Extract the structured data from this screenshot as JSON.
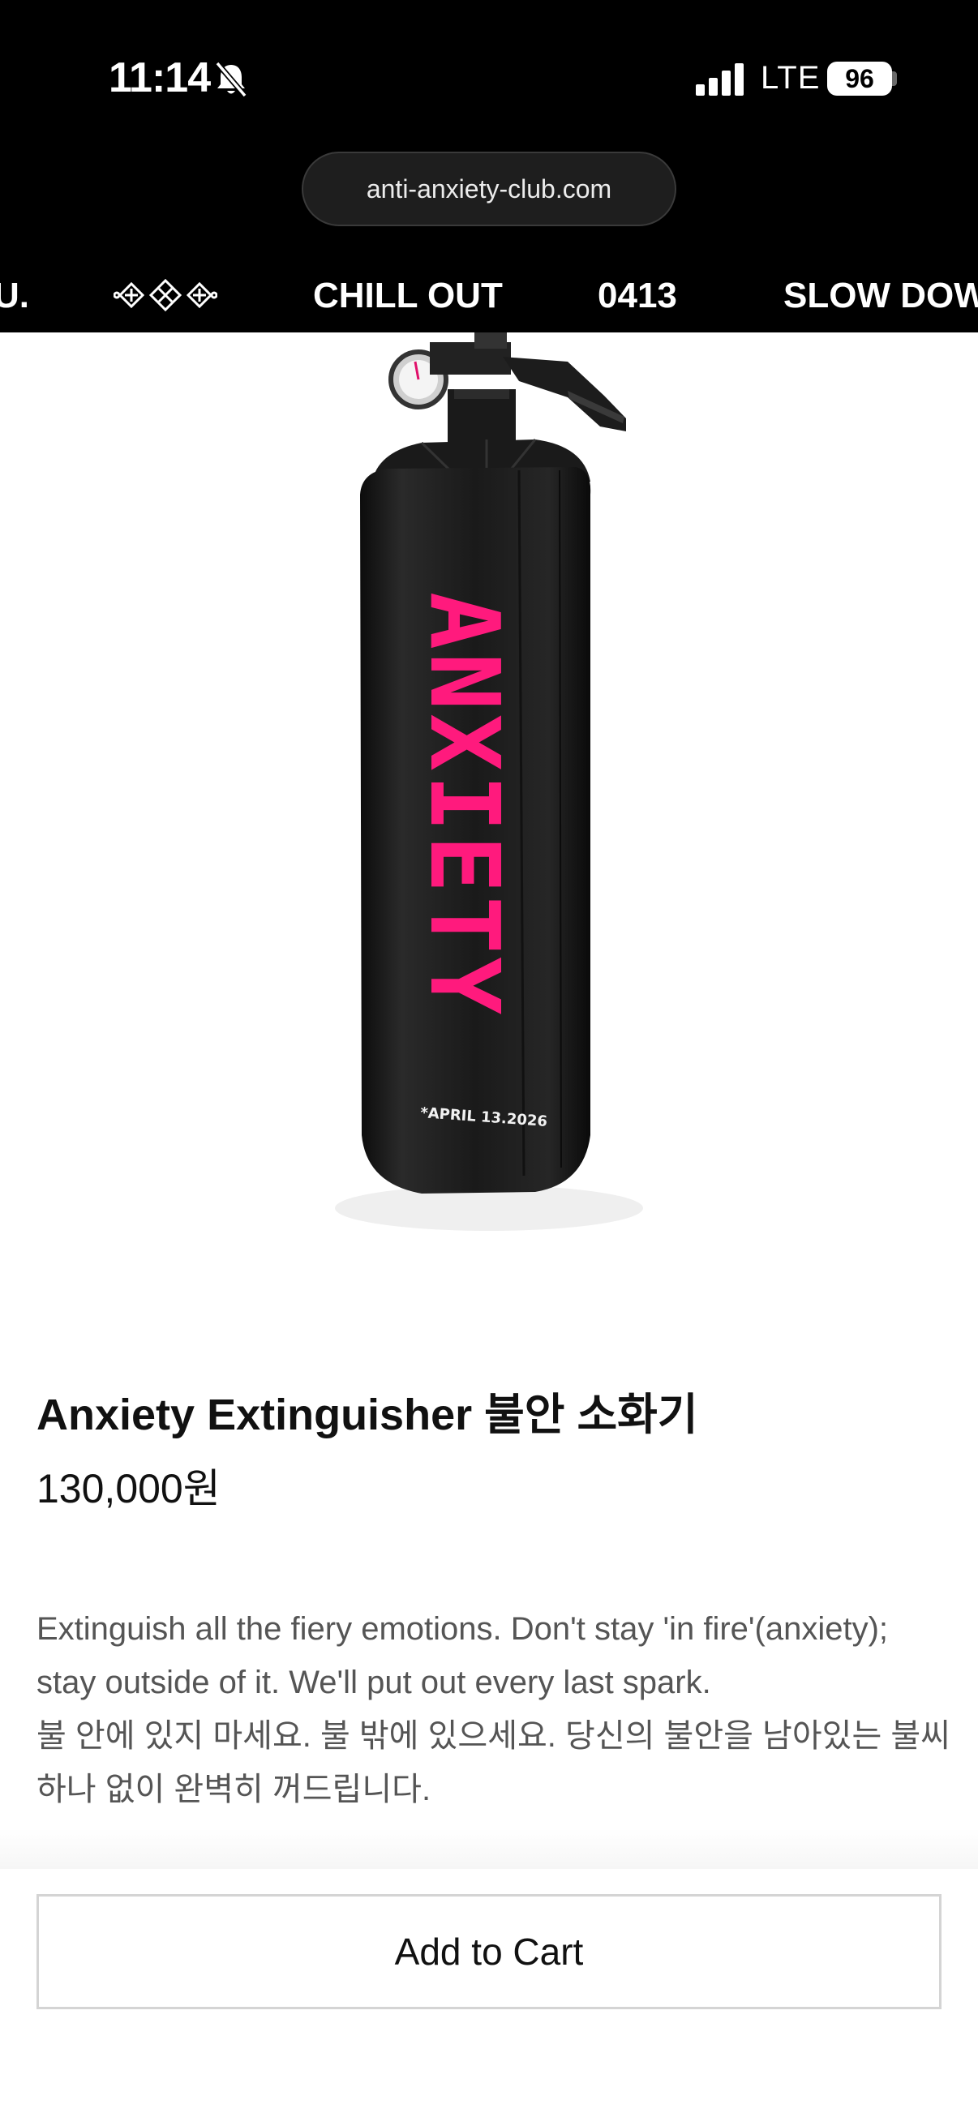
{
  "status_bar": {
    "time": "11:14",
    "network": "LTE",
    "battery": "96"
  },
  "browser": {
    "url": "anti-anxiety-club.com"
  },
  "nav": {
    "items": [
      "U.",
      "CHILL OUT",
      "0413",
      "SLOW DOW"
    ]
  },
  "product": {
    "image_print_text": "ANXIETY",
    "image_date_text": "*APRIL 13.2026",
    "title": "Anxiety Extinguisher 불안 소화기",
    "price": "130,000원",
    "description": [
      "Extinguish all the fiery emotions. Don't stay 'in fire'(anxiety);",
      "stay outside of it. We'll put out every last spark.",
      "불 안에 있지 마세요. 불 밖에 있으세요. 당신의 불안을 남아있는 불씨",
      "하나 없이 완벽히 꺼드립니다."
    ]
  },
  "actions": {
    "add_to_cart": "Add to Cart"
  },
  "colors": {
    "accent_pink": "#ff1a7d",
    "bar_black": "#000000"
  }
}
